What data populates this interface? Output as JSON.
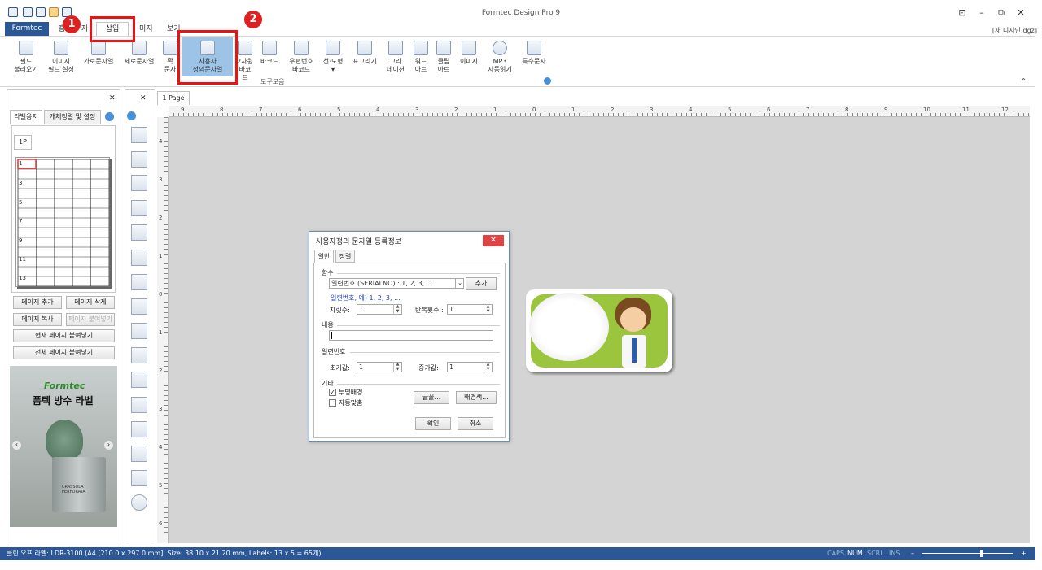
{
  "app_title": "Formtec Design Pro 9",
  "doc_name": "[새 디자인.dgz]",
  "window_controls": [
    "⊡",
    "–",
    "⧉",
    "✕"
  ],
  "ribbon": {
    "brand_tab": "Formtec",
    "tabs": [
      "홈",
      "삽입",
      "이미지",
      "보기"
    ],
    "tab_fragments": {
      "home": "홈",
      "insert_partial": "자",
      "image": "|미지",
      "view": "보기"
    },
    "buttons": [
      {
        "label1": "필드",
        "label2": "불러오기"
      },
      {
        "label1": "이미지",
        "label2": "필드 설정"
      },
      {
        "label1": "가로문자열",
        "label2": ""
      },
      {
        "label1": "세로문자열",
        "label2": ""
      },
      {
        "label1": "확",
        "label2": "문자"
      },
      {
        "label1": "사용자",
        "label2": "정의문자열"
      },
      {
        "label1": "2차원",
        "label2": "바코드"
      },
      {
        "label1": "바코드",
        "label2": ""
      },
      {
        "label1": "우편번호",
        "label2": "바코드"
      },
      {
        "label1": "선·도형",
        "label2": "▾"
      },
      {
        "label1": "표그리기",
        "label2": ""
      },
      {
        "label1": "그라",
        "label2": "데이션"
      },
      {
        "label1": "워드",
        "label2": "아트"
      },
      {
        "label1": "클립",
        "label2": "아트"
      },
      {
        "label1": "이미지",
        "label2": ""
      },
      {
        "label1": "MP3",
        "label2": "자동읽기"
      },
      {
        "label1": "특수문자",
        "label2": ""
      }
    ],
    "group_label": "도구모음"
  },
  "annotations": {
    "badge1": "1",
    "badge2": "2"
  },
  "left_panel": {
    "tab1": "라벨용지",
    "tab2": "개체정렬 및 설정",
    "page_tab": "1P",
    "row_numbers": [
      "1",
      "3",
      "5",
      "7",
      "9",
      "11",
      "13"
    ],
    "buttons": {
      "add_page": "페이지 추가",
      "delete_page": "페이지 삭제",
      "copy_page": "페이지 복사",
      "paste_page": "페이지 붙여넣기",
      "paste_current": "현재 페이지 붙여넣기",
      "paste_all": "전체 페이지 붙여넣기"
    },
    "ad": {
      "brand": "Formtec",
      "headline": "폼텍 방수 라벨",
      "pot_text1": "CRASSULA",
      "pot_text2": "PERFORATA"
    }
  },
  "canvas": {
    "page_tab": "1 Page",
    "ruler_top": [
      "9",
      "8",
      "7",
      "6",
      "5",
      "4",
      "3",
      "2",
      "1",
      "0",
      "1",
      "2",
      "3",
      "4",
      "5",
      "6",
      "7",
      "8",
      "9",
      "10",
      "11",
      "12"
    ],
    "ruler_left": [
      "4",
      "3",
      "2",
      "1",
      "0",
      "1",
      "2",
      "3",
      "4",
      "5",
      "6"
    ]
  },
  "dialog": {
    "title": "사용자정의 문자열 등록정보",
    "close": "✕",
    "tabs": [
      "일반",
      "정렬"
    ],
    "section_function": "함수",
    "function_value": "일련번호 (SERIALNO) : 1, 2, 3, ...",
    "add_button": "추가",
    "example_text": "일련번호, 예) 1, 2, 3, ...",
    "digits_label": "자릿수:",
    "digits_value": "1",
    "repeat_label": "반복횟수 :",
    "repeat_value": "1",
    "section_content": "내용",
    "content_value": "",
    "section_serial": "일련번호",
    "initial_label": "초기값:",
    "initial_value": "1",
    "increment_label": "증가값:",
    "increment_value": "1",
    "section_other": "기타",
    "transparent_bg": "투명배경",
    "transparent_checked": "✓",
    "auto_fit": "자동맞춤",
    "font_button": "글꼴...",
    "bgcolor_button": "배경색...",
    "ok": "확인",
    "cancel": "취소"
  },
  "status": {
    "text": "클린 오프 라벨: LDR-3100 (A4 [210.0 x 297.0 mm], Size: 38.10 x 21.20 mm,  Labels: 13 x 5 = 65개)",
    "caps": "CAPS",
    "num": "NUM",
    "scrl": "SCRL",
    "ins": "INS",
    "zoom_minus": "–",
    "zoom_plus": "+"
  }
}
